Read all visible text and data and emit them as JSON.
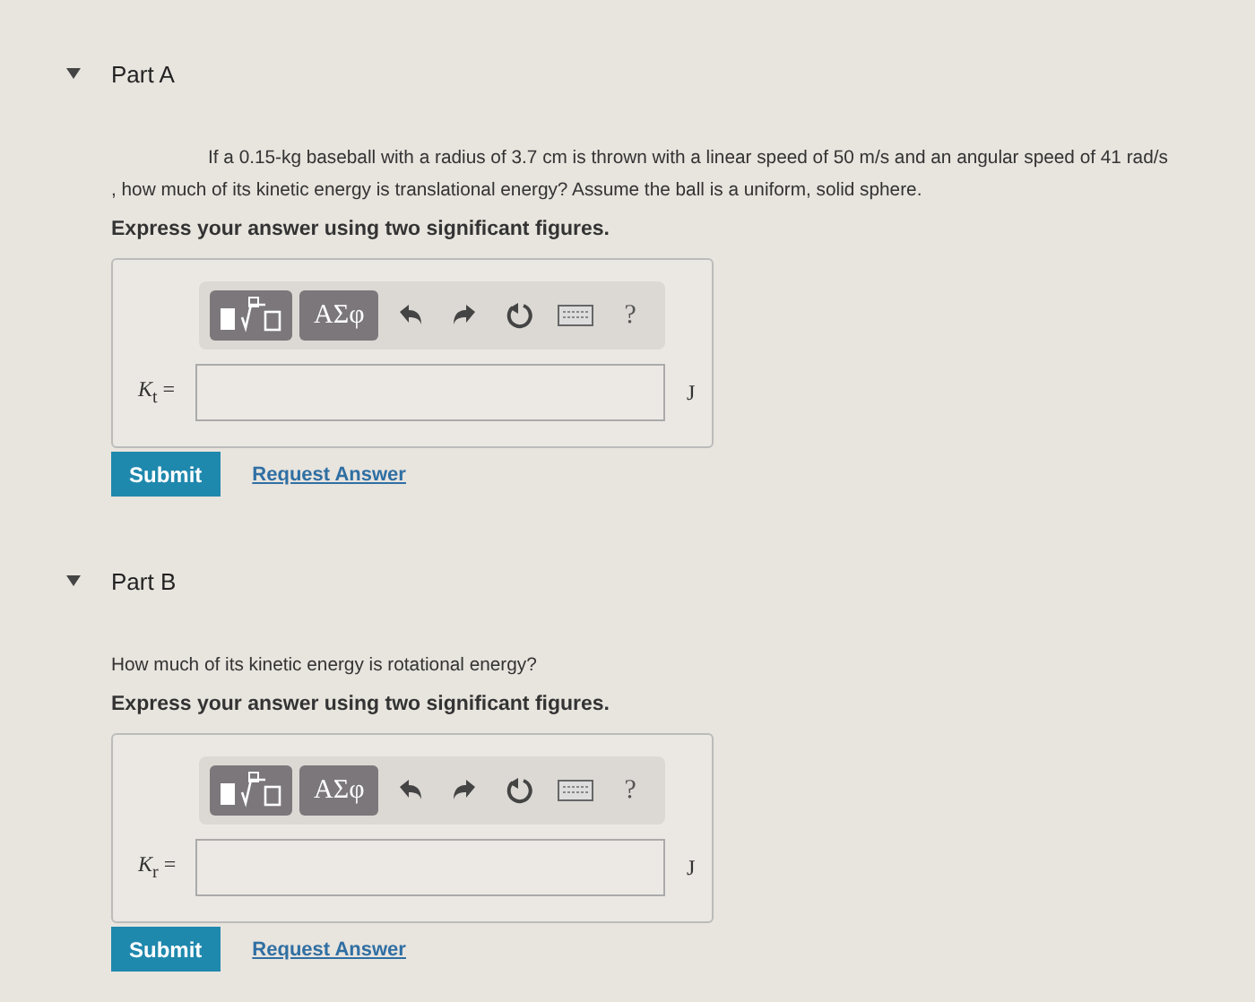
{
  "parts": [
    {
      "title": "Part A",
      "expanded": true,
      "question": "If a 0.15-kg baseball with a radius of 3.7 cm is thrown with a linear speed of 50 m/s and an angular speed of 41 rad/s , how much of its kinetic energy is translational energy? Assume the ball is a uniform, solid sphere.",
      "indent": true,
      "instruction": "Express your answer using two significant figures.",
      "toolbar": [
        {
          "kind": "templates"
        },
        {
          "kind": "greek",
          "label": "ΑΣφ"
        },
        {
          "kind": "undo"
        },
        {
          "kind": "redo"
        },
        {
          "kind": "reset"
        },
        {
          "kind": "keyboard"
        },
        {
          "kind": "help",
          "label": "?"
        }
      ],
      "label": "*K*$_{t}$ =",
      "unit": "J",
      "submit": "Submit",
      "request": "Request Answer"
    },
    {
      "title": "Part B",
      "expanded": true,
      "question": "How much of its kinetic energy is rotational energy?",
      "indent": false,
      "instruction": "Express your answer using two significant figures.",
      "toolbar": [
        {
          "kind": "templates"
        },
        {
          "kind": "greek",
          "label": "ΑΣφ"
        },
        {
          "kind": "undo"
        },
        {
          "kind": "redo"
        },
        {
          "kind": "reset"
        },
        {
          "kind": "keyboard"
        },
        {
          "kind": "help",
          "label": "?"
        }
      ],
      "label": "*K*$_{r}$ =",
      "unit": "J",
      "submit": "Submit",
      "request": "Request Answer"
    }
  ]
}
